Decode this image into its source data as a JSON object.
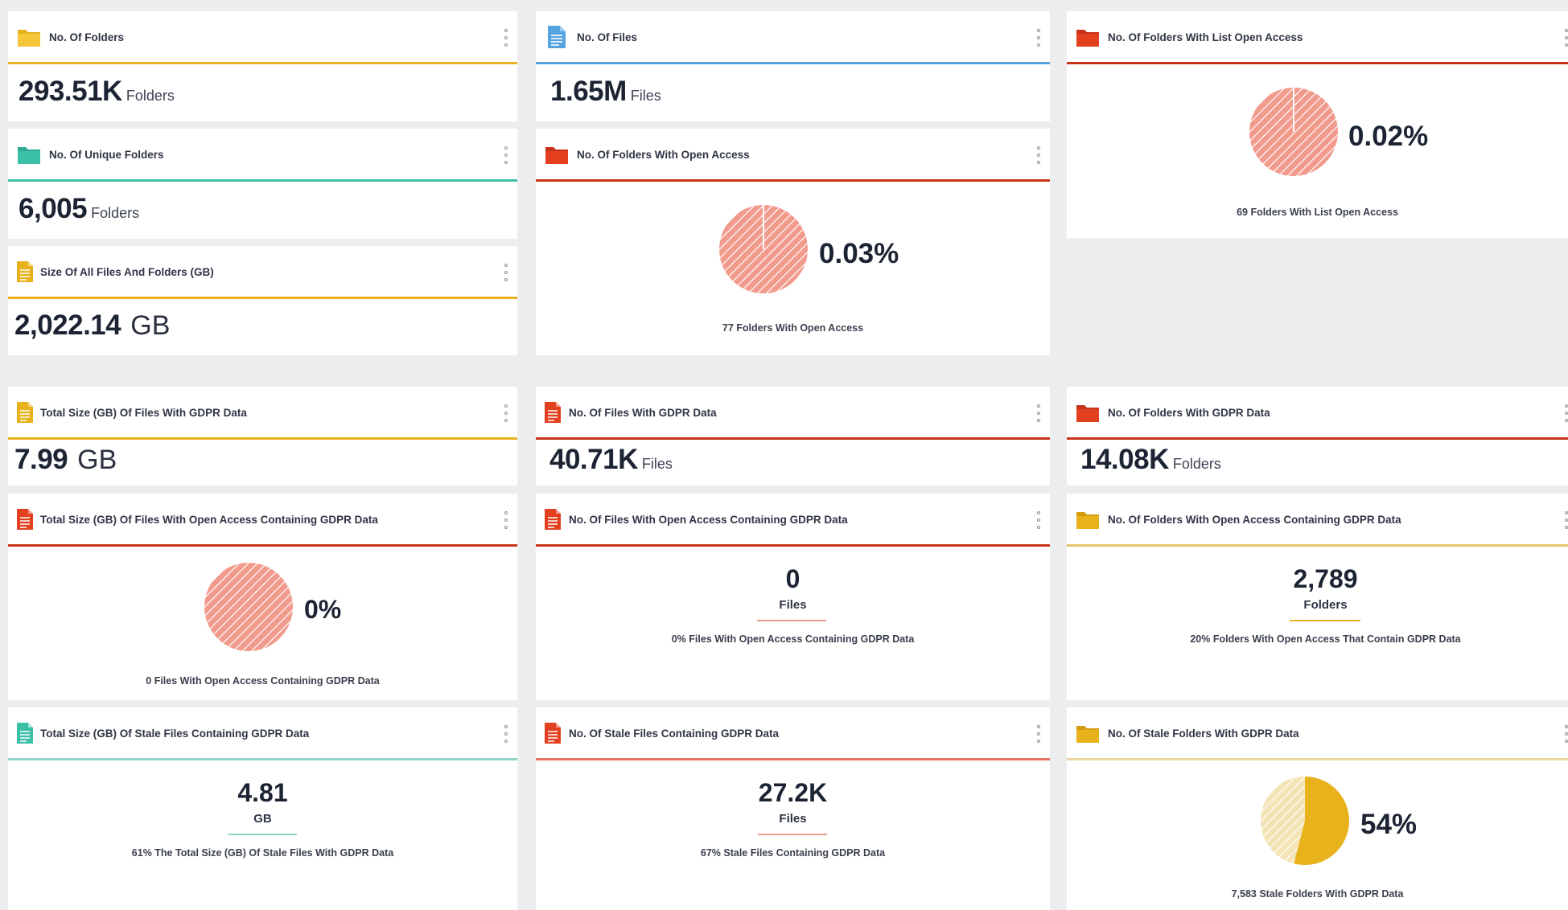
{
  "colors": {
    "yellow": "#e8b21c",
    "blue": "#55a4e0",
    "red": "#e34020",
    "teal": "#3cbfa7",
    "pink": "#f29a8c",
    "pale_yellow": "#f3e3b5"
  },
  "cards": {
    "folders": {
      "title": "No. Of Folders",
      "value": "293.51K",
      "unit": "Folders",
      "icon": "folder-icon"
    },
    "files": {
      "title": "No. Of Files",
      "value": "1.65M",
      "unit": "Files",
      "icon": "file-icon"
    },
    "list_open": {
      "title": "No. Of Folders With List Open Access",
      "percent": "0.02%",
      "share": 0.0002,
      "caption": "69 Folders With List Open Access",
      "icon": "folder-icon"
    },
    "unique": {
      "title": "No. Of Unique Folders",
      "value": "6,005",
      "unit": "Folders",
      "icon": "folder-icon"
    },
    "open_access": {
      "title": "No. Of Folders With Open Access",
      "percent": "0.03%",
      "share": 0.0003,
      "caption": "77 Folders With Open Access",
      "icon": "folder-icon"
    },
    "size_all": {
      "title": "Size Of All Files And Folders (GB)",
      "value": "2,022.14",
      "unit": "GB",
      "icon": "file-icon"
    },
    "gdpr_size": {
      "title": "Total Size (GB) Of Files With GDPR Data",
      "value": "7.99",
      "unit": "GB",
      "icon": "file-icon"
    },
    "gdpr_files": {
      "title": "No. Of Files With GDPR Data",
      "value": "40.71K",
      "unit": "Files",
      "icon": "file-icon"
    },
    "gdpr_folders": {
      "title": "No. Of Folders With GDPR Data",
      "value": "14.08K",
      "unit": "Folders",
      "icon": "folder-icon"
    },
    "open_gdpr_size": {
      "title": "Total Size (GB) Of Files With Open Access Containing GDPR Data",
      "percent": "0%",
      "share": 0,
      "caption": "0 Files With Open Access Containing GDPR Data",
      "icon": "file-icon"
    },
    "open_gdpr_files": {
      "title": "No. Of Files With Open Access Containing GDPR Data",
      "value": "0",
      "unit": "Files",
      "caption": "0% Files With Open Access Containing GDPR Data",
      "icon": "file-icon"
    },
    "open_gdpr_folders": {
      "title": "No. Of Folders With Open Access Containing GDPR Data",
      "value": "2,789",
      "unit": "Folders",
      "caption": "20% Folders With Open Access That Contain GDPR Data",
      "icon": "folder-icon"
    },
    "stale_size": {
      "title": "Total Size (GB) Of Stale Files Containing GDPR Data",
      "value": "4.81",
      "unit": "GB",
      "caption": "61% The Total Size (GB) Of Stale Files With GDPR Data",
      "icon": "file-icon"
    },
    "stale_files": {
      "title": "No. Of Stale Files Containing GDPR Data",
      "value": "27.2K",
      "unit": "Files",
      "caption": "67% Stale Files Containing GDPR Data",
      "icon": "file-icon"
    },
    "stale_folders": {
      "title": "No. Of Stale Folders With GDPR Data",
      "percent": "54%",
      "share": 0.54,
      "caption": "7,583 Stale Folders With GDPR Data",
      "icon": "folder-icon"
    }
  }
}
